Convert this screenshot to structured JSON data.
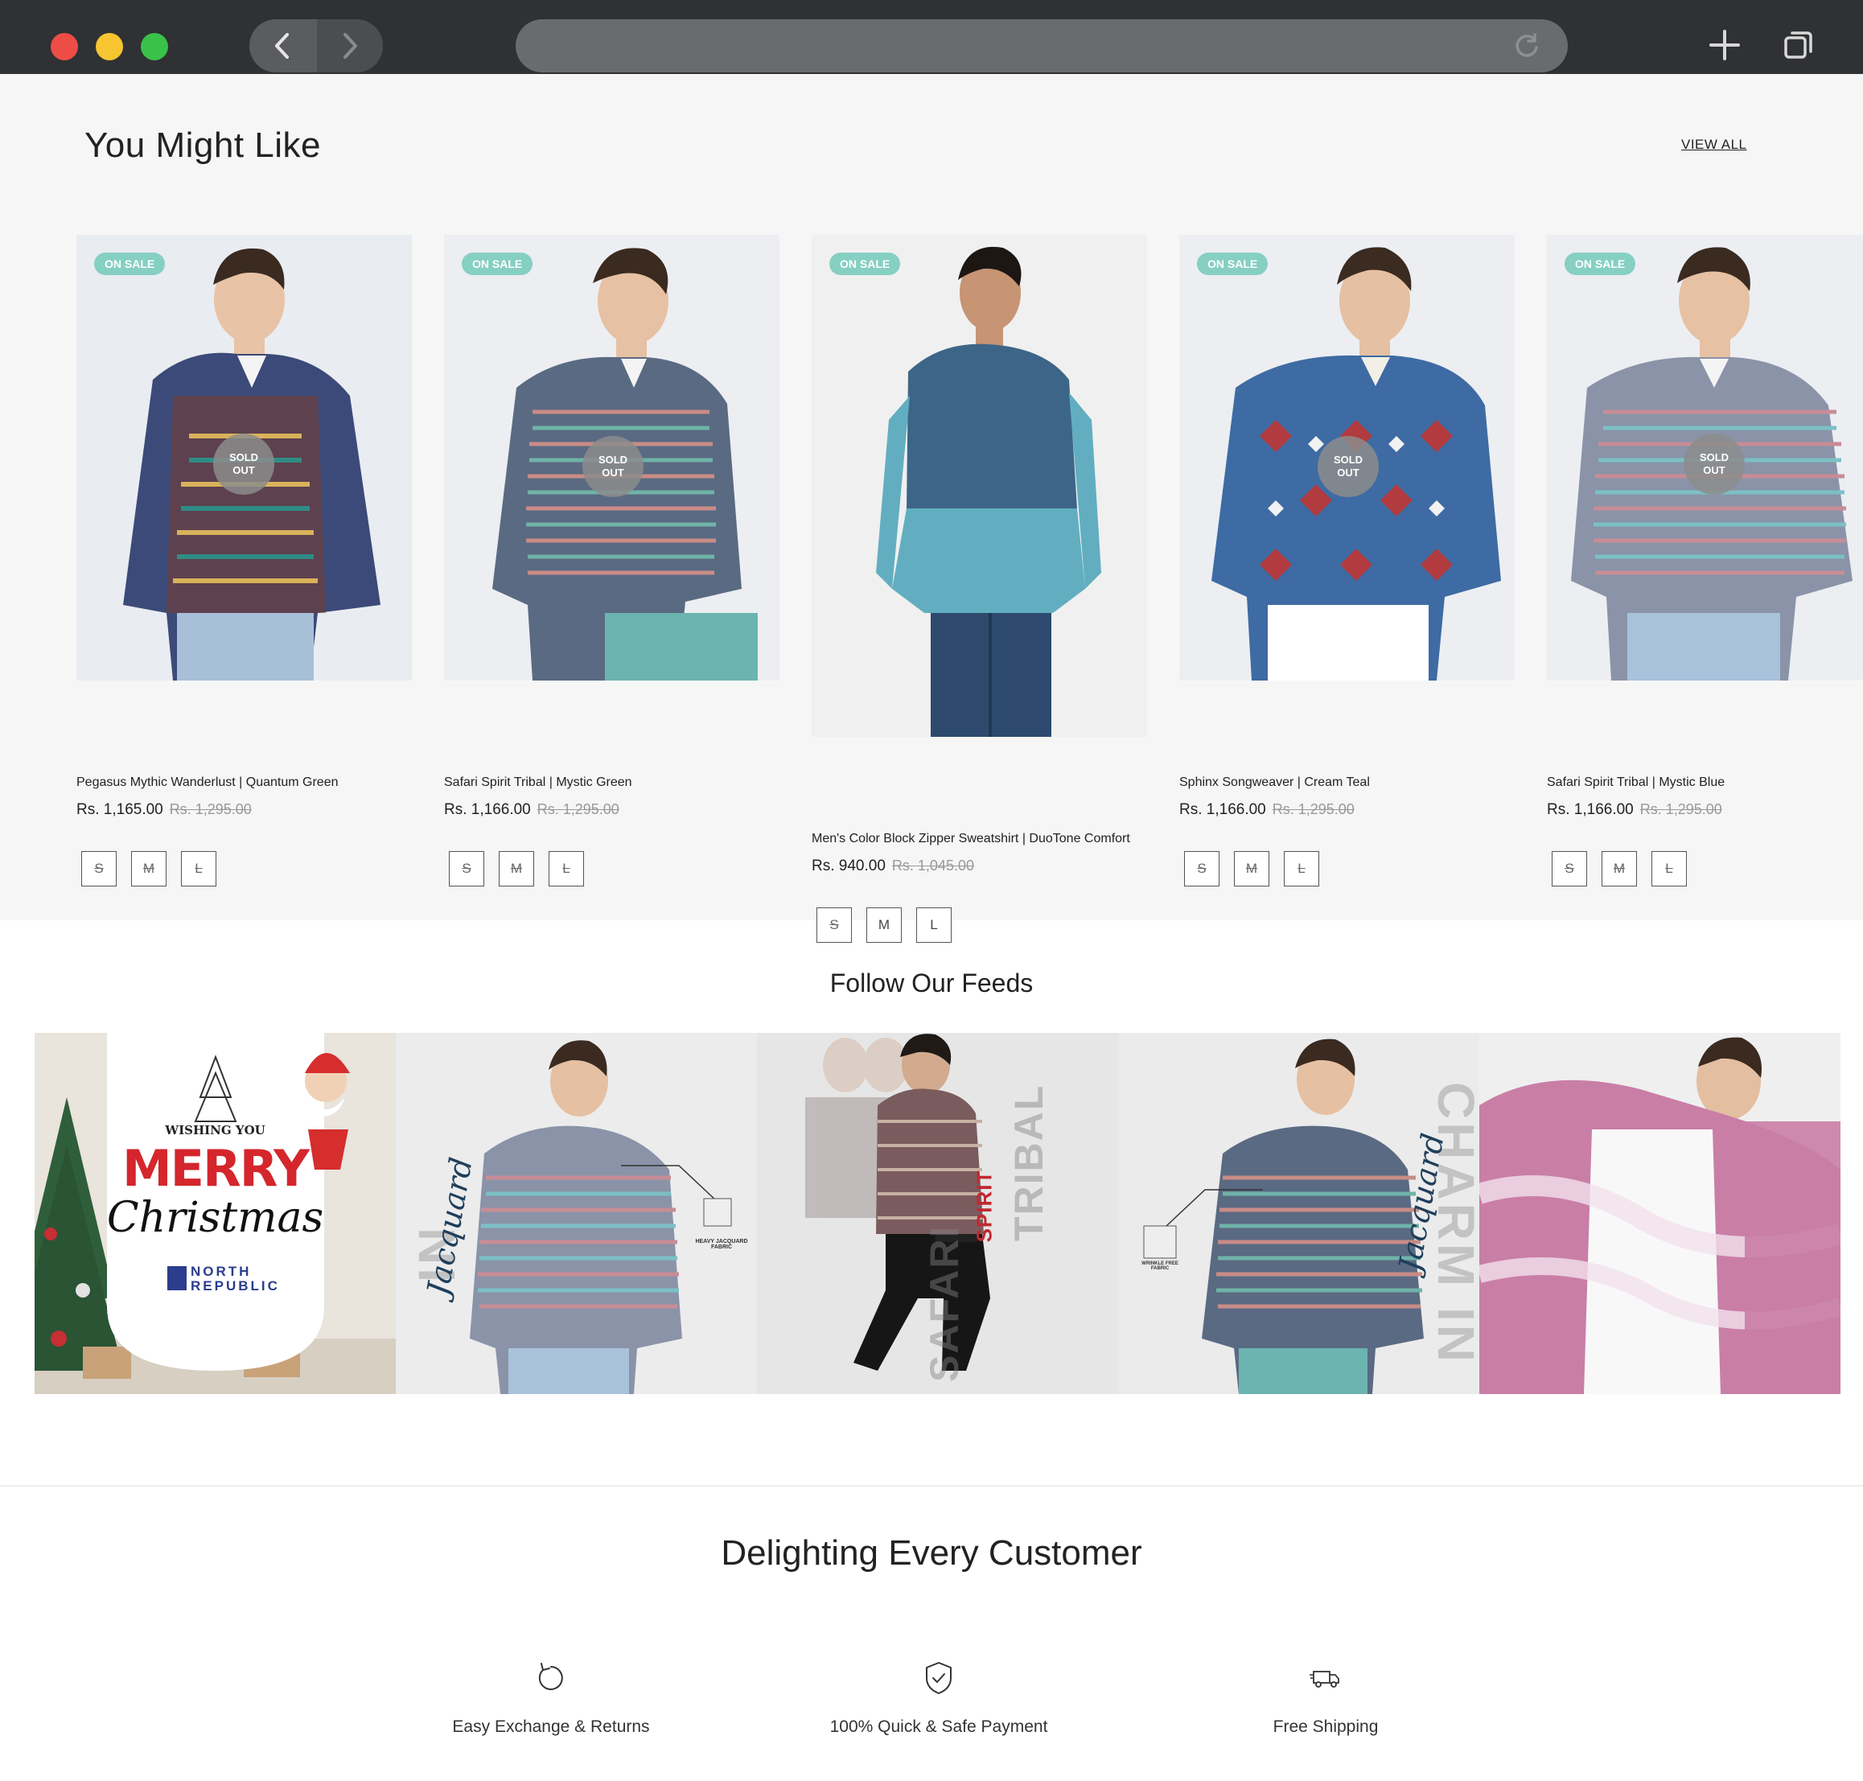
{
  "section_recommend": {
    "title": "You Might Like",
    "view_all": "VIEW ALL",
    "badge_sale": "ON SALE",
    "sold_out_line1": "SOLD",
    "sold_out_line2": "OUT",
    "products": [
      {
        "name": "Pegasus Mythic Wanderlust | Quantum Green",
        "price": "Rs. 1,165.00",
        "old_price": "Rs. 1,295.00",
        "sold_out": true,
        "sizes": [
          "S",
          "M",
          "L"
        ],
        "shirt_color": "#3b4a78"
      },
      {
        "name": "Safari Spirit Tribal | Mystic Green",
        "price": "Rs. 1,166.00",
        "old_price": "Rs. 1,295.00",
        "sold_out": true,
        "sizes": [
          "S",
          "M",
          "L"
        ],
        "shirt_color": "#5a6a82"
      },
      {
        "name": "Men's Color Block Zipper Sweatshirt | DuoTone Comfort",
        "price": "Rs. 940.00",
        "old_price": "Rs. 1,045.00",
        "sold_out": false,
        "sizes": [
          "S",
          "M",
          "L"
        ],
        "shirt_color": "#5ea9bb"
      },
      {
        "name": "Sphinx Songweaver | Cream Teal",
        "price": "Rs. 1,166.00",
        "old_price": "Rs. 1,295.00",
        "sold_out": true,
        "sizes": [
          "S",
          "M",
          "L"
        ],
        "shirt_color": "#3e6ba3"
      },
      {
        "name": "Safari Spirit Tribal | Mystic Blue",
        "price": "Rs. 1,166.00",
        "old_price": "Rs. 1,295.00",
        "sold_out": true,
        "sizes": [
          "S",
          "M",
          "L"
        ],
        "shirt_color": "#8a93a8"
      }
    ]
  },
  "section_feeds": {
    "title": "Follow Our Feeds",
    "posts": [
      {
        "kind": "christmas",
        "line1": "WISHING YOU",
        "line2": "MERRY",
        "line3": "Christmas",
        "brand1": "NORTH",
        "brand2": "REPUBLIC"
      },
      {
        "kind": "elegance",
        "big_text": "ELEGANCE IN",
        "script_text": "Jacquard",
        "callout": "HEAVY JACQUARD FABRIC"
      },
      {
        "kind": "safari",
        "big_text": "TRIBAL",
        "mid_text": "SPIRIT",
        "low_text": "SAFARI"
      },
      {
        "kind": "charm",
        "big_text": "CHARM IN",
        "script_text": "Jacquard",
        "callout": "WRINKLE FREE FABRIC"
      },
      {
        "kind": "tiedye"
      }
    ]
  },
  "section_delight": {
    "title": "Delighting Every Customer",
    "features": [
      {
        "label": "Easy Exchange & Returns",
        "icon": "exchange-icon"
      },
      {
        "label": "100% Quick & Safe Payment",
        "icon": "shield-check-icon"
      },
      {
        "label": "Free Shipping",
        "icon": "truck-icon"
      }
    ]
  }
}
